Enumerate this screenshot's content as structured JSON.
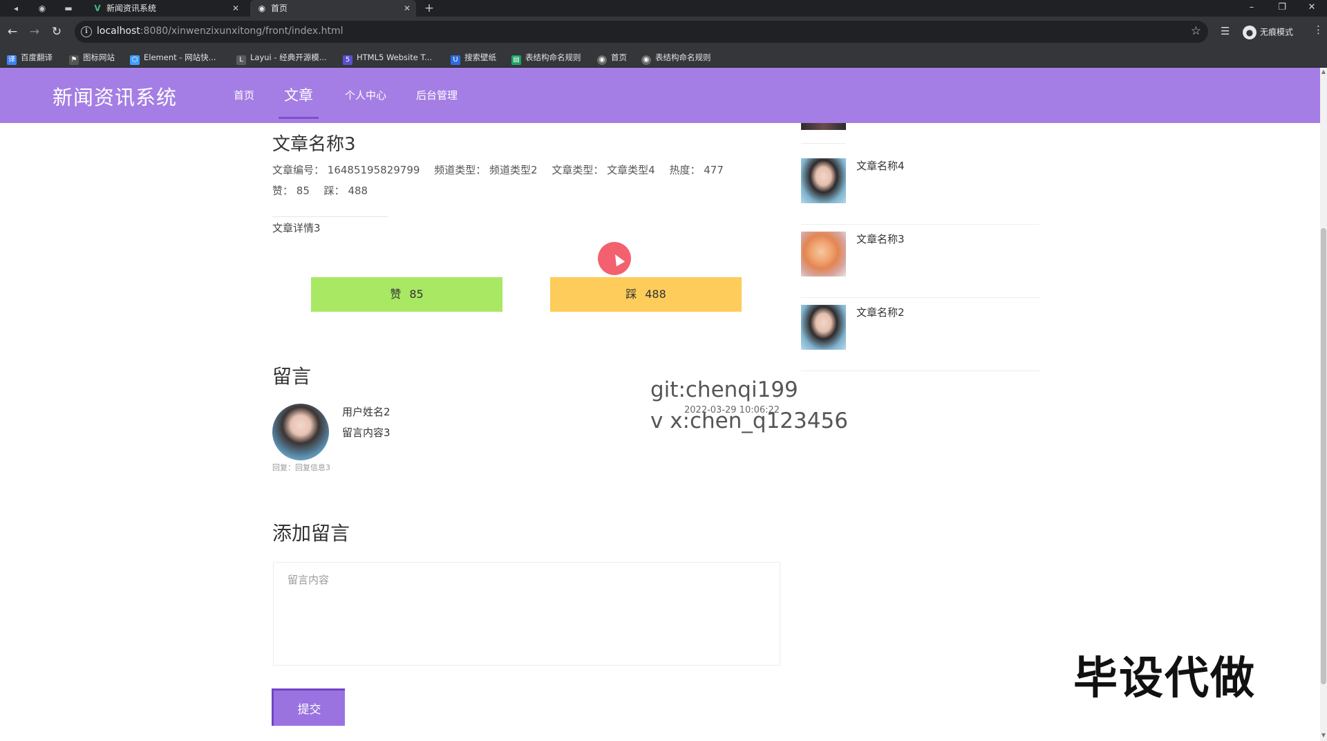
{
  "browser": {
    "tabs": [
      {
        "label": "新闻资讯系统",
        "icon": "vue-icon",
        "active": false
      },
      {
        "label": "首页",
        "icon": "globe-icon",
        "active": true
      }
    ],
    "new_tab": "+",
    "url_host": "localhost",
    "url_rest": ":8080/xinwenzixunxitong/front/index.html",
    "profile_label": "无痕模式",
    "bookmarks": [
      {
        "label": "百度翻译",
        "icon": "baidu-translate-icon",
        "color": "#3b82f6"
      },
      {
        "label": "图标网站",
        "icon": "flag-icon",
        "color": "#555555"
      },
      {
        "label": "Element - 网站快...",
        "icon": "element-icon",
        "color": "#409eff"
      },
      {
        "label": "Layui - 经典开源模...",
        "icon": "layui-icon",
        "color": "#5b5b5b"
      },
      {
        "label": "HTML5 Website T...",
        "icon": "html5-icon",
        "color": "#5b4fcf"
      },
      {
        "label": "搜索壁纸",
        "icon": "wallpaper-icon",
        "color": "#2d6cdf"
      },
      {
        "label": "表结构命名规则",
        "icon": "sheet-icon",
        "color": "#1ba462"
      },
      {
        "label": "首页",
        "icon": "globe-icon",
        "color": "#6b6b6b"
      },
      {
        "label": "表结构命名规则",
        "icon": "globe-icon",
        "color": "#6b6b6b"
      }
    ]
  },
  "site": {
    "logo": "新闻资讯系统",
    "nav": [
      {
        "label": "首页",
        "active": false
      },
      {
        "label": "文章",
        "active": true
      },
      {
        "label": "个人中心",
        "active": false
      },
      {
        "label": "后台管理",
        "active": false
      }
    ],
    "header_color": "#a47ee4"
  },
  "article": {
    "title": "文章名称3",
    "meta": [
      {
        "label": "文章编号：",
        "value": "16485195829799"
      },
      {
        "label": "频道类型：",
        "value": "频道类型2"
      },
      {
        "label": "文章类型：",
        "value": "文章类型4"
      },
      {
        "label": "热度：",
        "value": "477"
      }
    ],
    "likes_label": "赞：",
    "likes": "85",
    "dislikes_label": "踩：",
    "dislikes": "488",
    "detail": "文章详情3",
    "like_button": {
      "label": "赞",
      "count": "85"
    },
    "dislike_button": {
      "label": "踩",
      "count": "488"
    }
  },
  "comments": {
    "heading": "留言",
    "items": [
      {
        "user": "用户姓名2",
        "content": "留言内容3",
        "reply": "回复：回复信息3",
        "time": "2022-03-29 10:06:22"
      }
    ]
  },
  "add_comment": {
    "heading": "添加留言",
    "placeholder": "留言内容",
    "submit": "提交"
  },
  "sidebar": {
    "items": [
      {
        "title": "文章名称4",
        "thumb": "portrait-blue"
      },
      {
        "title": "文章名称3",
        "thumb": "portrait-orange"
      },
      {
        "title": "文章名称2",
        "thumb": "portrait-blue"
      }
    ]
  },
  "overlay": {
    "watermark_line1": "git:chenqi199",
    "watermark_line2": "v x:chen_q123456",
    "corner_text": "毕设代做"
  }
}
